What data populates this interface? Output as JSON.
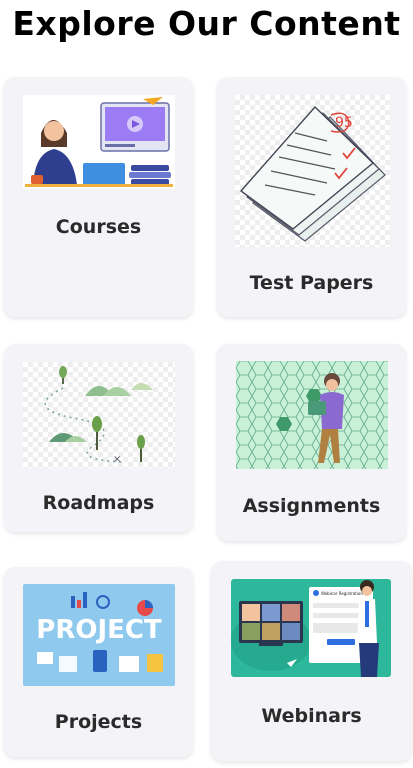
{
  "page": {
    "title": "Explore Our Content"
  },
  "cards": [
    {
      "label": "Courses",
      "icon": "online-course-illustration"
    },
    {
      "label": "Test Papers",
      "icon": "test-papers-illustration"
    },
    {
      "label": "Roadmaps",
      "icon": "roadmap-illustration"
    },
    {
      "label": "Assignments",
      "icon": "assignment-illustration"
    },
    {
      "label": "Projects",
      "icon": "project-illustration"
    },
    {
      "label": "Webinars",
      "icon": "webinar-illustration"
    }
  ],
  "thumbnails": {
    "projects_word": "PROJECT",
    "webinar_header": "Webinar Registration"
  },
  "colors": {
    "card_bg": "#f4f3f8",
    "mint_bg": "#c9f1d8",
    "teal_bg": "#2eb89b",
    "sky_bg": "#8fc9ee"
  }
}
